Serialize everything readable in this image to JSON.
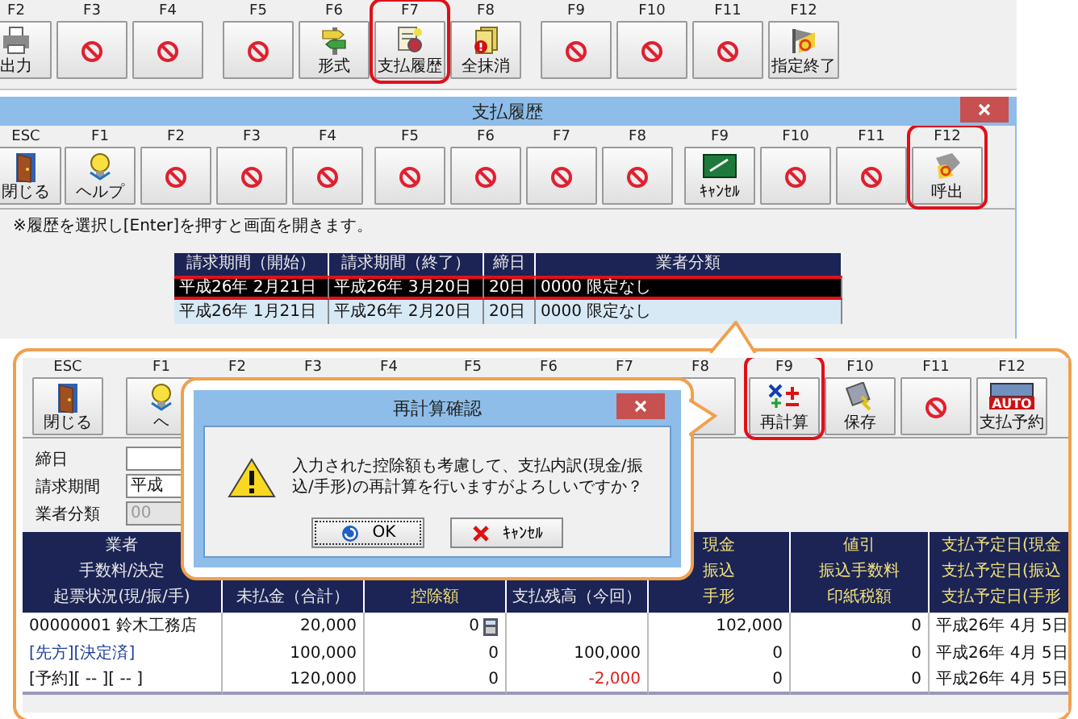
{
  "main_toolbar": {
    "groups": [
      [
        {
          "key": "F2",
          "label": "出力",
          "kind": "print",
          "highlighted": false
        },
        {
          "key": "F3",
          "kind": "disabled",
          "highlighted": false
        },
        {
          "key": "F4",
          "kind": "disabled",
          "highlighted": false
        }
      ],
      [
        {
          "key": "F5",
          "kind": "disabled",
          "highlighted": false
        },
        {
          "key": "F6",
          "label": "形式",
          "kind": "format",
          "highlighted": false
        },
        {
          "key": "F7",
          "label": "支払履歴",
          "kind": "history",
          "highlighted": true
        },
        {
          "key": "F8",
          "label": "全抹消",
          "kind": "clear",
          "highlighted": false
        }
      ],
      [
        {
          "key": "F9",
          "kind": "disabled",
          "highlighted": false
        },
        {
          "key": "F10",
          "kind": "disabled",
          "highlighted": false
        },
        {
          "key": "F11",
          "kind": "disabled",
          "highlighted": false
        },
        {
          "key": "F12",
          "label": "指定終了",
          "kind": "finish",
          "highlighted": false
        }
      ]
    ]
  },
  "history_window": {
    "title": "支払履歴",
    "toolbar": {
      "groups": [
        [
          {
            "key": "ESC",
            "label": "閉じる",
            "kind": "close",
            "highlighted": false
          }
        ],
        [
          {
            "key": "F1",
            "label": "ヘルプ",
            "kind": "help",
            "highlighted": false
          },
          {
            "key": "F2",
            "kind": "disabled",
            "highlighted": false
          },
          {
            "key": "F3",
            "kind": "disabled",
            "highlighted": false
          },
          {
            "key": "F4",
            "kind": "disabled",
            "highlighted": false
          }
        ],
        [
          {
            "key": "F5",
            "kind": "disabled",
            "highlighted": false
          },
          {
            "key": "F6",
            "kind": "disabled",
            "highlighted": false
          },
          {
            "key": "F7",
            "kind": "disabled",
            "highlighted": false
          },
          {
            "key": "F8",
            "kind": "disabled",
            "highlighted": false
          }
        ],
        [
          {
            "key": "F9",
            "label": "ｷｬﾝｾﾙ",
            "kind": "cancel",
            "highlighted": false
          },
          {
            "key": "F10",
            "kind": "disabled",
            "highlighted": false
          },
          {
            "key": "F11",
            "kind": "disabled",
            "highlighted": false
          },
          {
            "key": "F12",
            "label": "呼出",
            "kind": "recall",
            "highlighted": true
          }
        ]
      ]
    },
    "note": "※履歴を選択し[Enter]を押すと画面を開きます。",
    "table": {
      "columns": [
        "請求期間（開始）",
        "請求期間（終了）",
        "締日",
        "業者分類"
      ],
      "rows": [
        {
          "cells": [
            "平成26年 2月21日",
            "平成26年 3月20日",
            "20日",
            "0000 限定なし"
          ],
          "selected": true,
          "highlighted": true
        },
        {
          "cells": [
            "平成26年 1月21日",
            "平成26年 2月20日",
            "20日",
            "0000 限定なし"
          ],
          "selected": false,
          "highlighted": false
        }
      ]
    }
  },
  "payment_screen": {
    "toolbar": {
      "groups": [
        [
          {
            "key": "ESC",
            "label": "閉じる",
            "kind": "close",
            "highlighted": false
          }
        ],
        [
          {
            "key": "F1",
            "label": "ヘ",
            "kind": "help",
            "highlighted": false
          },
          {
            "key": "F2",
            "kind": "blank",
            "highlighted": false
          },
          {
            "key": "F3",
            "kind": "blank",
            "highlighted": false
          },
          {
            "key": "F4",
            "kind": "blank",
            "highlighted": false
          }
        ],
        [
          {
            "key": "F5",
            "kind": "blank",
            "highlighted": false
          },
          {
            "key": "F6",
            "kind": "blank",
            "highlighted": false
          },
          {
            "key": "F7",
            "kind": "blank",
            "highlighted": false
          },
          {
            "key": "F8",
            "kind": "blank",
            "highlighted": false
          }
        ],
        [
          {
            "key": "F9",
            "label": "再計算",
            "kind": "recalc",
            "highlighted": true
          },
          {
            "key": "F10",
            "label": "保存",
            "kind": "save",
            "highlighted": false
          },
          {
            "key": "F11",
            "kind": "disabled",
            "highlighted": false
          },
          {
            "key": "F12",
            "label": "支払予約",
            "kind": "reserve",
            "badge": "AUTO",
            "highlighted": false
          }
        ]
      ]
    },
    "fields": [
      {
        "label": "締日",
        "disabled": false
      },
      {
        "label": "請求期間",
        "value": "平成",
        "disabled": false
      },
      {
        "label": "業者分類",
        "value": "00",
        "disabled": true
      }
    ],
    "table": {
      "columns": [
        {
          "lines": [
            "業者",
            "手数料/決定",
            "起票状況(現/振/手)"
          ],
          "accent": false
        },
        {
          "lines": [
            "未払金（合計）"
          ],
          "accent": false
        },
        {
          "lines": [
            "控除額"
          ],
          "accent": true
        },
        {
          "lines": [
            "支払残高（今回）"
          ],
          "accent": false
        },
        {
          "lines": [
            "現金",
            "振込",
            "手形"
          ],
          "accent": true
        },
        {
          "lines": [
            "値引",
            "振込手数料",
            "印紙税額"
          ],
          "accent": true
        },
        {
          "lines": [
            "支払予定日(現金",
            "支払予定日(振込",
            "支払予定日(手形"
          ],
          "accent": true
        }
      ],
      "rows": [
        {
          "cells": [
            {
              "text": "00000001 鈴木工務店",
              "kind": "plain"
            },
            {
              "text": "20,000",
              "kind": "plain"
            },
            {
              "text": "0",
              "kind": "calculator"
            },
            {
              "kind": "plain"
            },
            {
              "text": "102,000",
              "kind": "plain"
            },
            {
              "text": "0",
              "kind": "plain"
            },
            {
              "text": "平成26年 4月 5日",
              "kind": "plain"
            }
          ]
        },
        {
          "cells": [
            {
              "text": "[先方][決定済]",
              "kind": "link"
            },
            {
              "text": "100,000",
              "kind": "plain"
            },
            {
              "text": "0",
              "kind": "plain"
            },
            {
              "text": "100,000",
              "kind": "plain"
            },
            {
              "text": "0",
              "kind": "plain"
            },
            {
              "text": "0",
              "kind": "plain"
            },
            {
              "text": "平成26年 4月 5日",
              "kind": "plain"
            }
          ]
        },
        {
          "cells": [
            {
              "text": "[予約][ -- ][ -- ]",
              "kind": "plain"
            },
            {
              "text": "120,000",
              "kind": "plain"
            },
            {
              "text": "0",
              "kind": "plain"
            },
            {
              "text": "-2,000",
              "kind": "negative"
            },
            {
              "text": "0",
              "kind": "plain"
            },
            {
              "text": "0",
              "kind": "plain"
            },
            {
              "text": "平成26年 4月 5日",
              "kind": "plain"
            }
          ]
        }
      ]
    }
  },
  "dialog": {
    "title": "再計算確認",
    "message": "入力された控除額も考慮して、支払内訳(現金/振込/手形)の再計算を行いますがよろしいですか？",
    "buttons": [
      {
        "label": "OK",
        "kind": "ok"
      },
      {
        "label": "ｷｬﾝｾﾙ",
        "kind": "cancel"
      }
    ]
  }
}
